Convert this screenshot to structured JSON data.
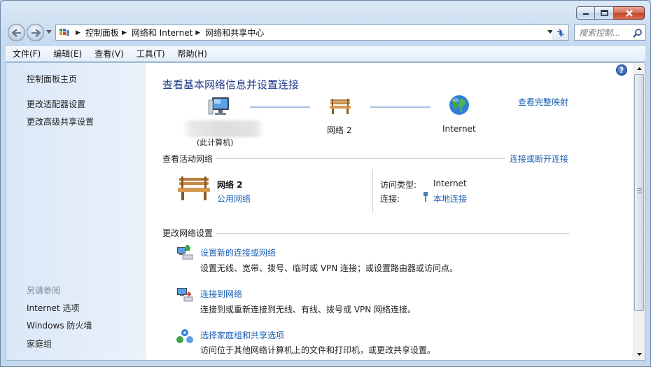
{
  "window": {
    "minimize_icon": "minimize-icon",
    "maximize_icon": "maximize-icon",
    "close_icon": "close-icon"
  },
  "navigation": {
    "breadcrumbs": [
      "控制面板",
      "网络和 Internet",
      "网络和共享中心"
    ],
    "search_placeholder": "搜索控制...",
    "icons": [
      "back-arrow-icon",
      "forward-arrow-icon",
      "refresh-icon",
      "search-icon",
      "control-panel-icon"
    ]
  },
  "menu": {
    "items": [
      "文件(F)",
      "编辑(E)",
      "查看(V)",
      "工具(T)",
      "帮助(H)"
    ]
  },
  "sidebar": {
    "top_links": [
      "控制面板主页",
      "更改适配器设置",
      "更改高级共享设置"
    ],
    "see_also_heading": "另请参阅",
    "see_also_links": [
      "Internet 选项",
      "Windows 防火墙",
      "家庭组"
    ]
  },
  "main": {
    "title": "查看基本网络信息并设置连接",
    "full_map_link": "查看完整映射",
    "map": {
      "computer_caption": "(此计算机)",
      "network_label": "网络  2",
      "internet_label": "Internet"
    },
    "active_networks": {
      "heading": "查看活动网络",
      "connect_link": "连接或断开连接",
      "network_name": "网络  2",
      "network_type": "公用网络",
      "access_type_label": "访问类型:",
      "access_type_value": "Internet",
      "connections_label": "连接:",
      "connections_value": "本地连接"
    },
    "change_settings": {
      "heading": "更改网络设置",
      "tasks": [
        {
          "title": "设置新的连接或网络",
          "desc": "设置无线、宽带、拨号、临时或 VPN 连接；或设置路由器或访问点。",
          "icon": "new-connection-icon"
        },
        {
          "title": "连接到网络",
          "desc": "连接到或重新连接到无线、有线、拨号或 VPN 网络连接。",
          "icon": "connect-network-icon"
        },
        {
          "title": "选择家庭组和共享选项",
          "desc": "访问位于其他网络计算机上的文件和打印机，或更改共享设置。",
          "icon": "homegroup-icon"
        }
      ]
    }
  },
  "colors": {
    "link": "#1a5fb4",
    "title": "#1e3b8a",
    "sidebar": "#dbe8f7"
  }
}
